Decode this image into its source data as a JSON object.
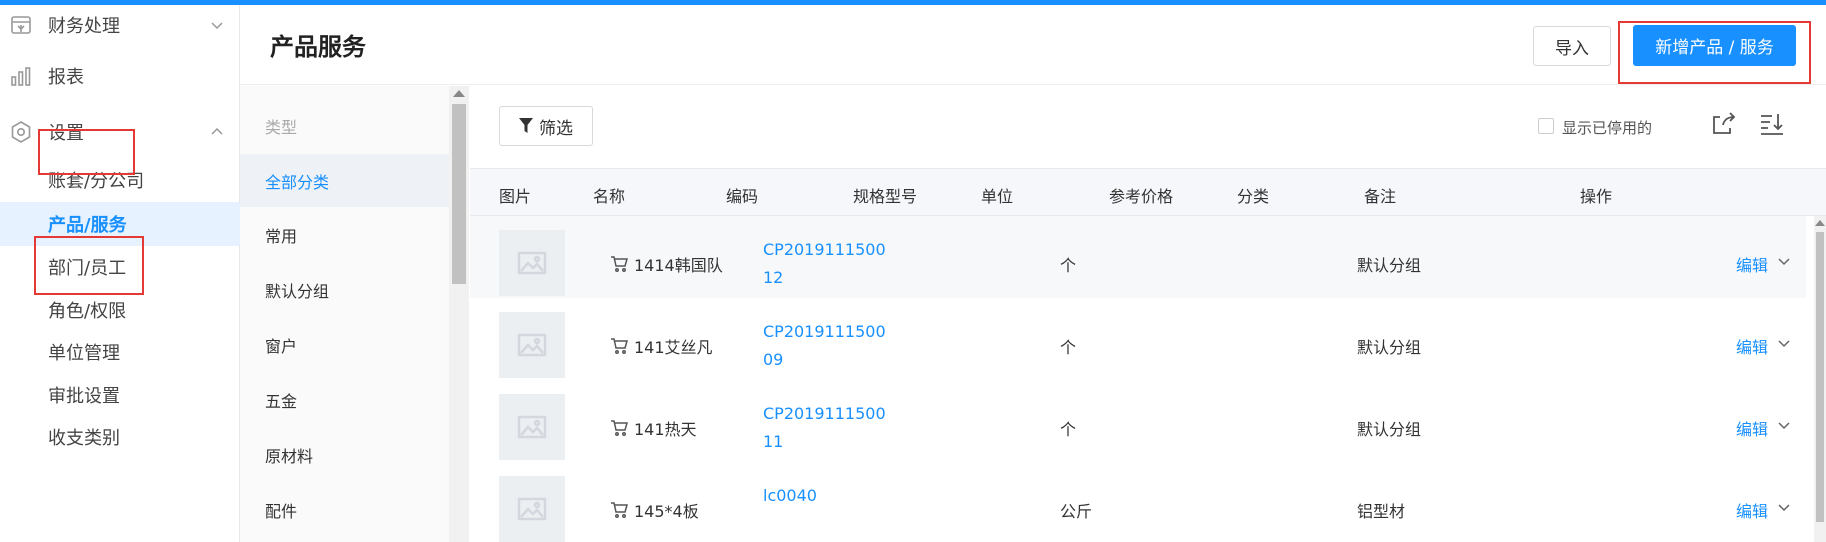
{
  "sidebar": {
    "groups": [
      {
        "label": "财务处理",
        "icon": "finance-icon"
      },
      {
        "label": "报表",
        "icon": "bar-chart-icon"
      },
      {
        "label": "设置",
        "icon": "settings-gear-icon"
      }
    ],
    "settings_items": [
      {
        "label": "账套/分公司"
      },
      {
        "label": "产品/服务",
        "active": true
      },
      {
        "label": "部门/员工"
      },
      {
        "label": "角色/权限"
      },
      {
        "label": "单位管理"
      },
      {
        "label": "审批设置"
      },
      {
        "label": "收支类别"
      }
    ]
  },
  "header": {
    "title": "产品服务",
    "import_label": "导入",
    "new_label": "新增产品 / 服务"
  },
  "categories": {
    "heading": "类型",
    "items": [
      "全部分类",
      "常用",
      "默认分组",
      "窗户",
      "五金",
      "原材料",
      "配件"
    ],
    "active_index": 0
  },
  "toolbar": {
    "filter_label": "筛选",
    "show_disabled_label": "显示已停用的",
    "show_disabled_checked": false
  },
  "table": {
    "columns": [
      "图片",
      "名称",
      "编码",
      "规格型号",
      "单位",
      "参考价格",
      "分类",
      "备注",
      "操作"
    ],
    "rows": [
      {
        "name": "1414韩国队",
        "code": "CP201911150012",
        "spec": "",
        "unit": "个",
        "price": "",
        "category": "默认分组",
        "note": "",
        "action": "编辑"
      },
      {
        "name": "141艾丝凡",
        "code": "CP201911150009",
        "spec": "",
        "unit": "个",
        "price": "",
        "category": "默认分组",
        "note": "",
        "action": "编辑"
      },
      {
        "name": "141热天",
        "code": "CP201911150011",
        "spec": "",
        "unit": "个",
        "price": "",
        "category": "默认分组",
        "note": "",
        "action": "编辑"
      },
      {
        "name": "145*4板",
        "code": "lc0040",
        "spec": "",
        "unit": "公斤",
        "price": "",
        "category": "铝型材",
        "note": "",
        "action": "编辑"
      }
    ]
  },
  "colors": {
    "accent": "#1890ff",
    "highlight_box": "#e53935",
    "active_bg": "#e6f2ff"
  }
}
